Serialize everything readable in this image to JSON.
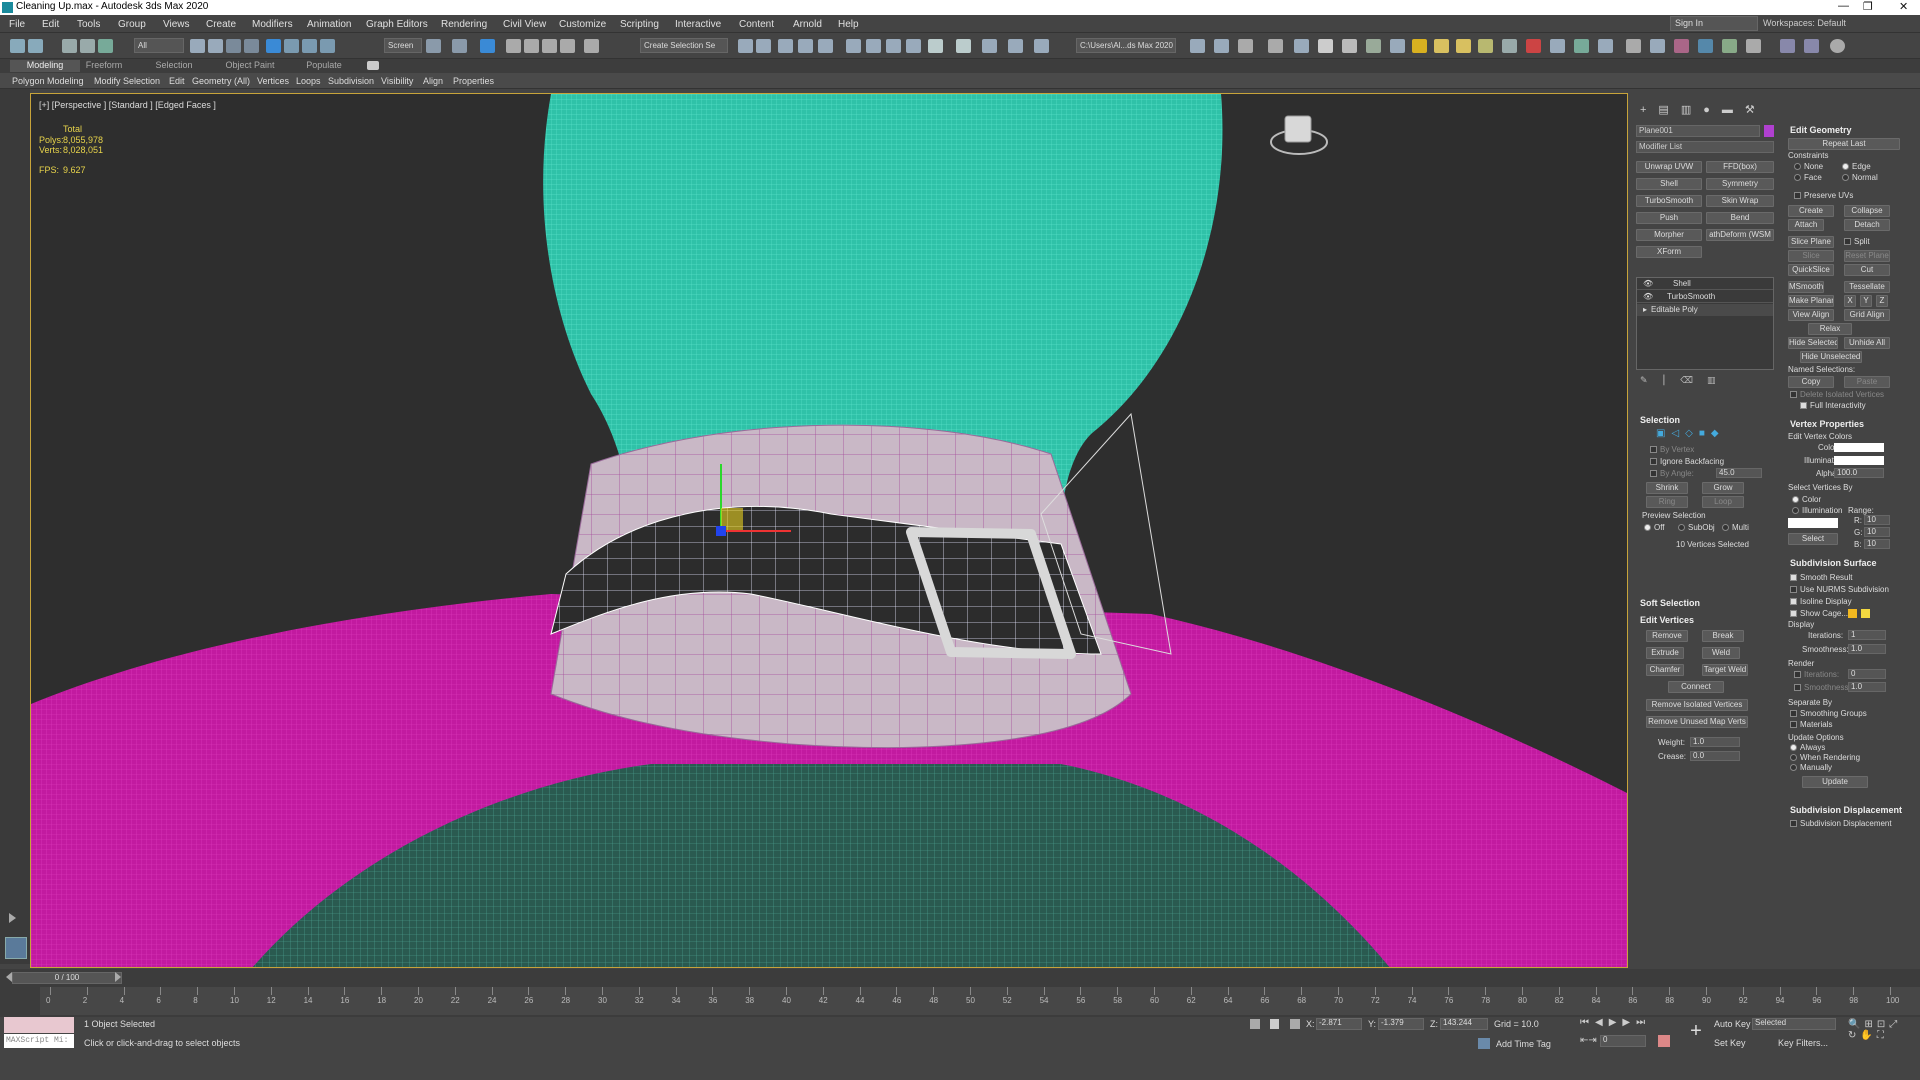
{
  "window": {
    "title": "Cleaning Up.max - Autodesk 3ds Max 2020",
    "controls": [
      "—",
      "❐",
      "✕"
    ]
  },
  "menu": [
    "File",
    "Edit",
    "Tools",
    "Group",
    "Views",
    "Create",
    "Modifiers",
    "Animation",
    "Graph Editors",
    "Rendering",
    "Civil View",
    "Customize",
    "Scripting",
    "Interactive",
    "Content",
    "Arnold",
    "Help"
  ],
  "account": {
    "signin": "Sign In",
    "workspace": "Workspaces: Default"
  },
  "toolbar": {
    "selection_filter": "All",
    "ref_coord": "Screen",
    "named_selection": "Create Selection Se",
    "project_path": "C:\\Users\\Al...ds Max 2020"
  },
  "ribbon": {
    "tabs": [
      "Modeling",
      "Freeform",
      "Selection",
      "Object Paint",
      "Populate"
    ],
    "active_tab": "Modeling",
    "items": [
      "Polygon Modeling",
      "Modify Selection",
      "Edit",
      "Geometry (All)",
      "Vertices",
      "Loops",
      "Subdivision",
      "Visibility",
      "Align",
      "Properties"
    ]
  },
  "viewport": {
    "label": "[+] [Perspective ] [Standard ] [Edged Faces ]",
    "stats": {
      "total_label": "Total",
      "polys_label": "Polys:",
      "polys": "8,055,978",
      "verts_label": "Verts:",
      "verts": "8,028,051",
      "fps_label": "FPS:",
      "fps": "9.627"
    }
  },
  "command_panel": {
    "object_name": "Plane001",
    "object_color": "#b040d0",
    "modifier_list": "Modifier List",
    "modifier_buttons": [
      "Unwrap UVW",
      "FFD(box)",
      "Shell",
      "Symmetry",
      "TurboSmooth",
      "Skin Wrap",
      "Push",
      "Bend",
      "Morpher",
      "athDeform (WSM",
      "XForm"
    ],
    "stack": [
      "Shell",
      "TurboSmooth",
      "Editable Poly"
    ],
    "selection": {
      "title": "Selection",
      "by_vertex": "By Vertex",
      "ignore_backfacing": "Ignore Backfacing",
      "by_angle": "By Angle:",
      "by_angle_value": "45.0",
      "shrink": "Shrink",
      "grow": "Grow",
      "ring": "Ring",
      "loop": "Loop",
      "preview_label": "Preview Selection",
      "preview_opts": [
        "Off",
        "SubObj",
        "Multi"
      ],
      "status": "10 Vertices Selected"
    },
    "soft_selection": "Soft Selection",
    "edit_vertices": {
      "title": "Edit Vertices",
      "remove": "Remove",
      "break": "Break",
      "extrude": "Extrude",
      "weld": "Weld",
      "chamfer": "Chamfer",
      "target_weld": "Target Weld",
      "connect": "Connect",
      "remove_isolated": "Remove Isolated Vertices",
      "remove_unused": "Remove Unused Map Verts",
      "weight_label": "Weight:",
      "weight": "1.0",
      "crease_label": "Crease:",
      "crease": "0.0"
    }
  },
  "edit_geometry": {
    "title": "Edit Geometry",
    "repeat_last": "Repeat Last",
    "constraints": "Constraints",
    "constraint_opts": [
      "None",
      "Edge",
      "Face",
      "Normal"
    ],
    "preserve_uvs": "Preserve UVs",
    "create": "Create",
    "collapse": "Collapse",
    "attach": "Attach",
    "detach": "Detach",
    "slice_plane": "Slice Plane",
    "split": "Split",
    "slice": "Slice",
    "reset_plane": "Reset Plane",
    "quickslice": "QuickSlice",
    "cut": "Cut",
    "msmooth": "MSmooth",
    "tessellate": "Tessellate",
    "make_planar": "Make Planar",
    "x": "X",
    "y": "Y",
    "z": "Z",
    "view_align": "View Align",
    "grid_align": "Grid Align",
    "relax": "Relax",
    "hide_selected": "Hide Selected",
    "unhide_all": "Unhide All",
    "hide_unselected": "Hide Unselected",
    "named_selections": "Named Selections:",
    "copy": "Copy",
    "paste": "Paste",
    "delete_isolated": "Delete Isolated Vertices",
    "full_interactivity": "Full Interactivity"
  },
  "vertex_properties": {
    "title": "Vertex Properties",
    "edit_vertex_colors": "Edit Vertex Colors",
    "color_label": "Color:",
    "illum_label": "Illumination:",
    "alpha_label": "Alpha:",
    "alpha": "100.0",
    "select_by": "Select Vertices By",
    "opt_color": "Color",
    "opt_illum": "Illumination",
    "range": "Range:",
    "r_label": "R:",
    "g_label": "G:",
    "b_label": "B:",
    "r": "10",
    "g": "10",
    "b": "10",
    "select": "Select"
  },
  "subdivision_surface": {
    "title": "Subdivision Surface",
    "smooth_result": "Smooth Result",
    "use_nurms": "Use NURMS Subdivision",
    "isoline": "Isoline Display",
    "show_cage": "Show Cage......",
    "display": "Display",
    "iter_label": "Iterations:",
    "iterations": "1",
    "smooth_label": "Smoothness:",
    "smoothness": "1.0",
    "render": "Render",
    "r_iterations": "0",
    "r_smoothness": "1.0",
    "separate_by": "Separate By",
    "smoothing_groups": "Smoothing Groups",
    "materials": "Materials",
    "update_options": "Update Options",
    "always": "Always",
    "when_rendering": "When Rendering",
    "manually": "Manually",
    "update": "Update"
  },
  "subdivision_displacement": {
    "title": "Subdivision Displacement",
    "check": "Subdivision Displacement"
  },
  "timeline": {
    "frame": "0 / 100",
    "ticks": [
      0,
      2,
      4,
      6,
      8,
      10,
      12,
      14,
      16,
      18,
      20,
      22,
      24,
      26,
      28,
      30,
      32,
      34,
      36,
      38,
      40,
      42,
      44,
      46,
      48,
      50,
      52,
      54,
      56,
      58,
      60,
      62,
      64,
      66,
      68,
      70,
      72,
      74,
      76,
      78,
      80,
      82,
      84,
      86,
      88,
      90,
      92,
      94,
      96,
      98,
      100
    ]
  },
  "status": {
    "maxscript": "MAXScript Mi:",
    "selected": "1 Object Selected",
    "prompt": "Click or click-and-drag to select objects",
    "x_label": "X:",
    "x": "-2.871",
    "y_label": "Y:",
    "y": "-1.379",
    "z_label": "Z:",
    "z": "143.244",
    "grid": "Grid = 10.0",
    "add_time_tag": "Add Time Tag",
    "auto_key": "Auto Key",
    "set_key": "Set Key",
    "key_mode": "Selected",
    "key_filters": "Key Filters...",
    "frame_field": "0"
  }
}
